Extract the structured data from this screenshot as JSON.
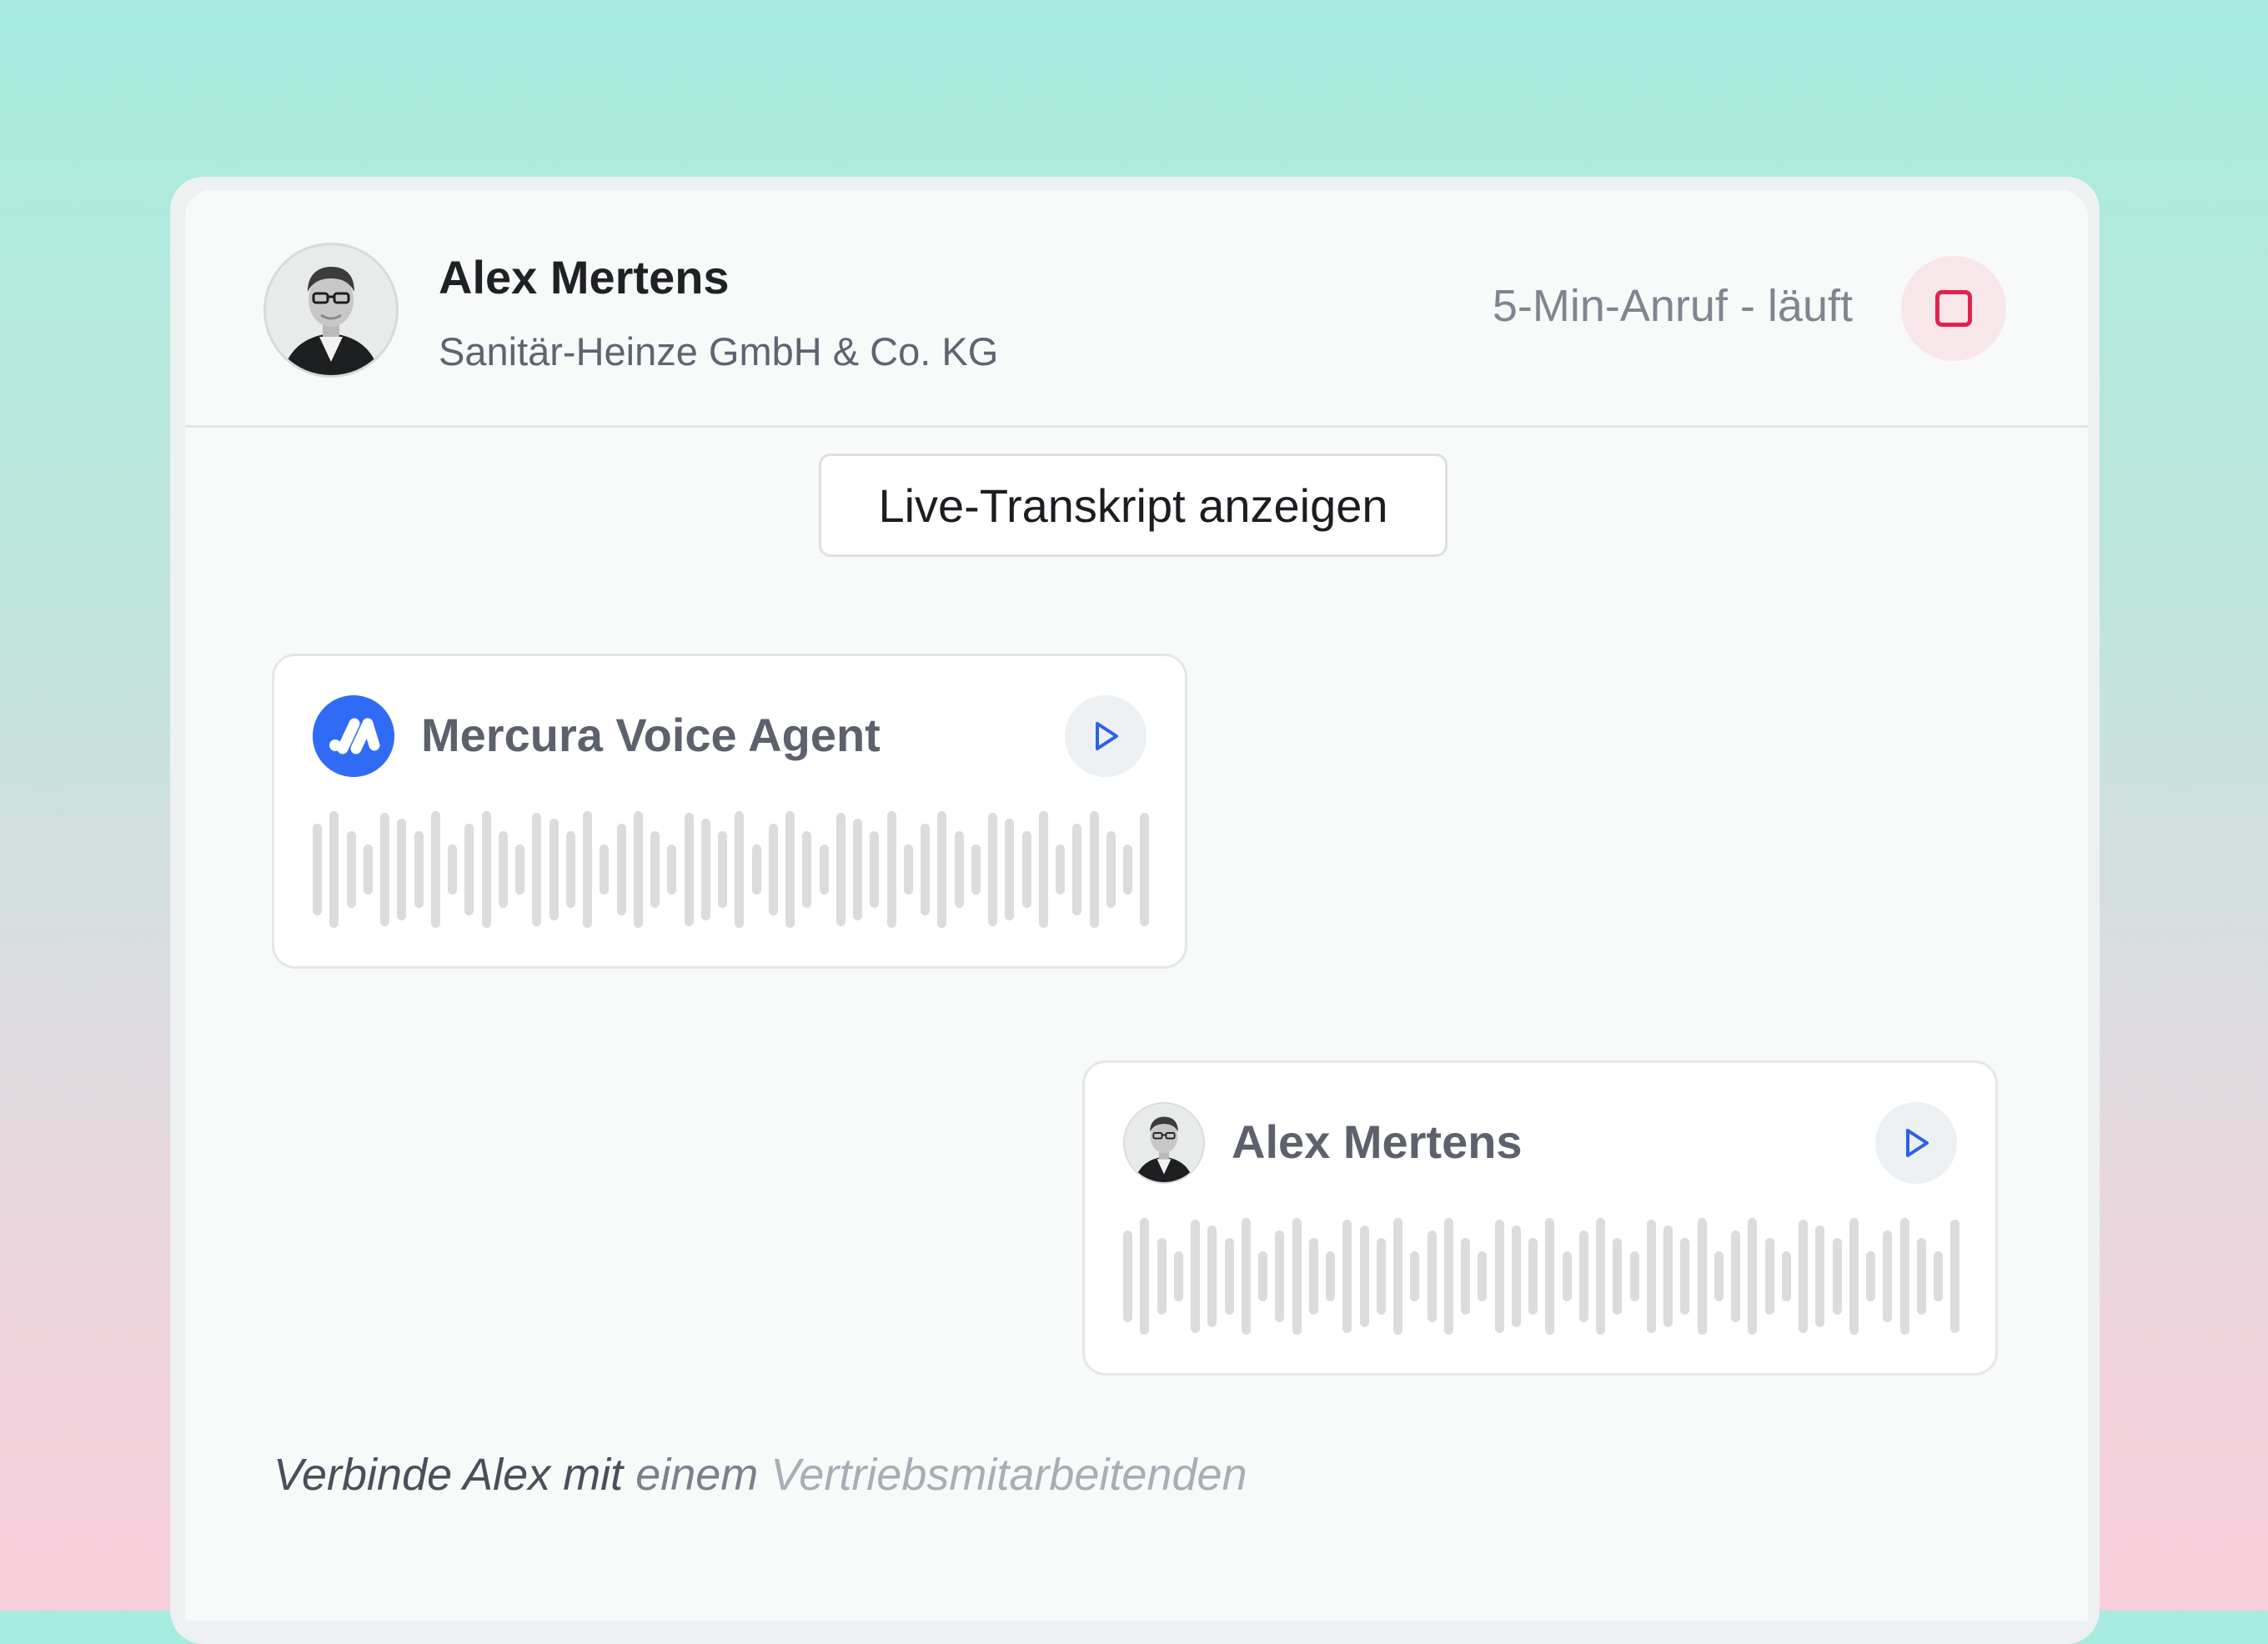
{
  "header": {
    "caller_name": "Alex Mertens",
    "caller_company": "Sanitär-Heinze GmbH & Co. KG",
    "call_status": "5-Min-Anruf - läuft",
    "stop_icon": "stop-icon"
  },
  "transcript_button": {
    "label": "Live-Transkript anzeigen"
  },
  "messages": [
    {
      "sender": "Mercura Voice Agent",
      "icon": "mercura-logo-icon",
      "play_icon": "play-icon"
    },
    {
      "sender": "Alex Mertens",
      "icon": "avatar",
      "play_icon": "play-icon"
    }
  ],
  "status_line": {
    "part1": "Verbinde Alex mit",
    "part2": "einem",
    "part3": "Vertriebsmitarbeitenden"
  },
  "colors": {
    "accent_blue": "#2f6bf5",
    "stop_red": "#e1224e",
    "waveform": "#dadcde"
  }
}
